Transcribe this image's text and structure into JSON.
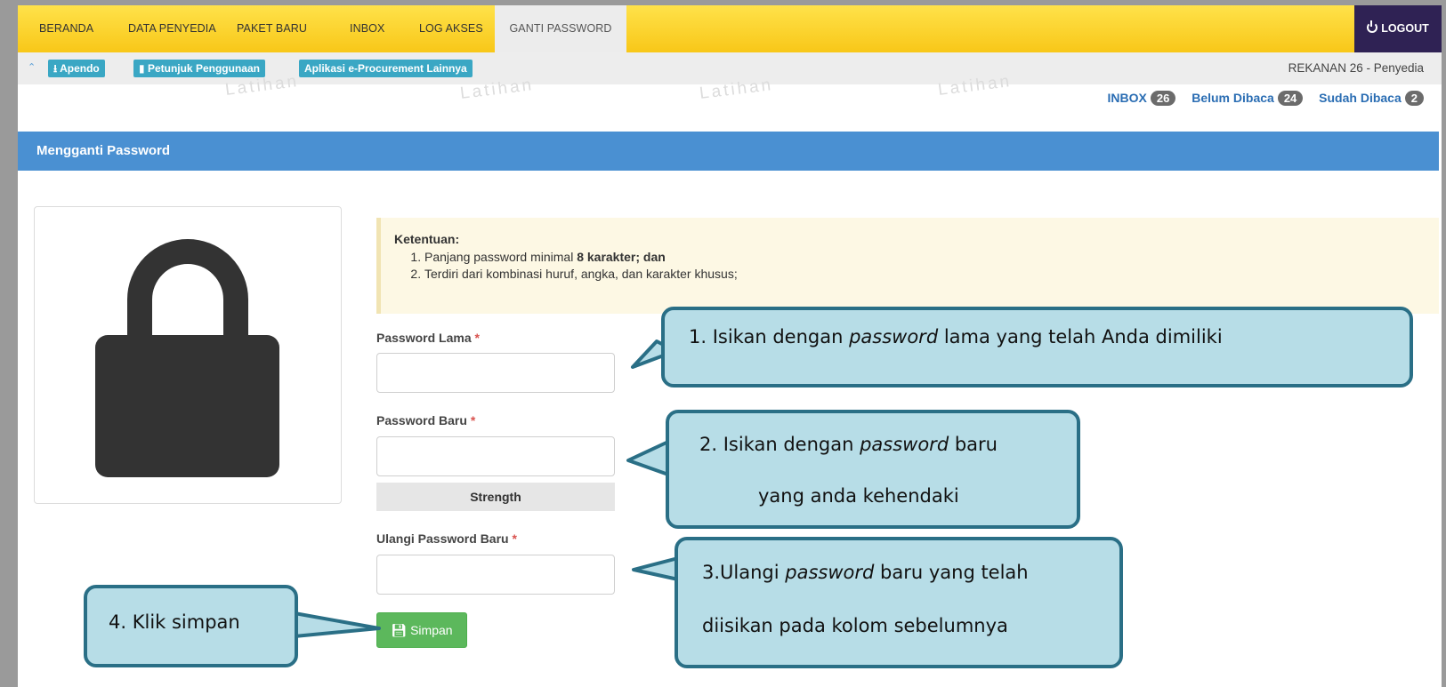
{
  "nav": {
    "items": [
      "BERANDA",
      "DATA PENYEDIA",
      "PAKET BARU",
      "INBOX",
      "LOG AKSES",
      "GANTI PASSWORD"
    ],
    "logout": "LOGOUT"
  },
  "subbar": {
    "apendo": "Apendo",
    "petunjuk": "Petunjuk Penggunaan",
    "aplikasi": "Aplikasi e-Procurement Lainnya",
    "user": "REKANAN 26 - Penyedia"
  },
  "watermark": "Latihan",
  "inbox": {
    "inbox_label": "INBOX",
    "inbox_count": "26",
    "unread_label": "Belum Dibaca",
    "unread_count": "24",
    "read_label": "Sudah Dibaca",
    "read_count": "2"
  },
  "panel": {
    "title": "Mengganti Password"
  },
  "rules": {
    "title": "Ketentuan:",
    "item1_a": "Panjang password minimal ",
    "item1_b": "8 karakter; dan",
    "item2": "Terdiri dari kombinasi huruf, angka, dan karakter khusus;"
  },
  "form": {
    "old_label": "Password Lama",
    "new_label": "Password Baru",
    "strength": "Strength",
    "repeat_label": "Ulangi Password Baru",
    "required": "*",
    "save": "Simpan"
  },
  "callouts": {
    "c1_a": "1. Isikan dengan ",
    "c1_b": "password",
    "c1_c": " lama yang telah Anda dimiliki",
    "c2_a": "2. Isikan dengan ",
    "c2_b": "password",
    "c2_c": " baru",
    "c2_line2": "yang anda kehendaki",
    "c3_a": "3.Ulangi ",
    "c3_b": "password",
    "c3_c": " baru yang telah",
    "c3_line2": "diisikan pada kolom sebelumnya",
    "c4": "4. Klik simpan"
  },
  "colors": {
    "nav_bg": "#f8c718",
    "logout_bg": "#2f2254",
    "panel_header": "#4a90d2",
    "save_button": "#5cb85c",
    "callout_fill": "#b7dde7",
    "callout_border": "#2a6f86"
  }
}
